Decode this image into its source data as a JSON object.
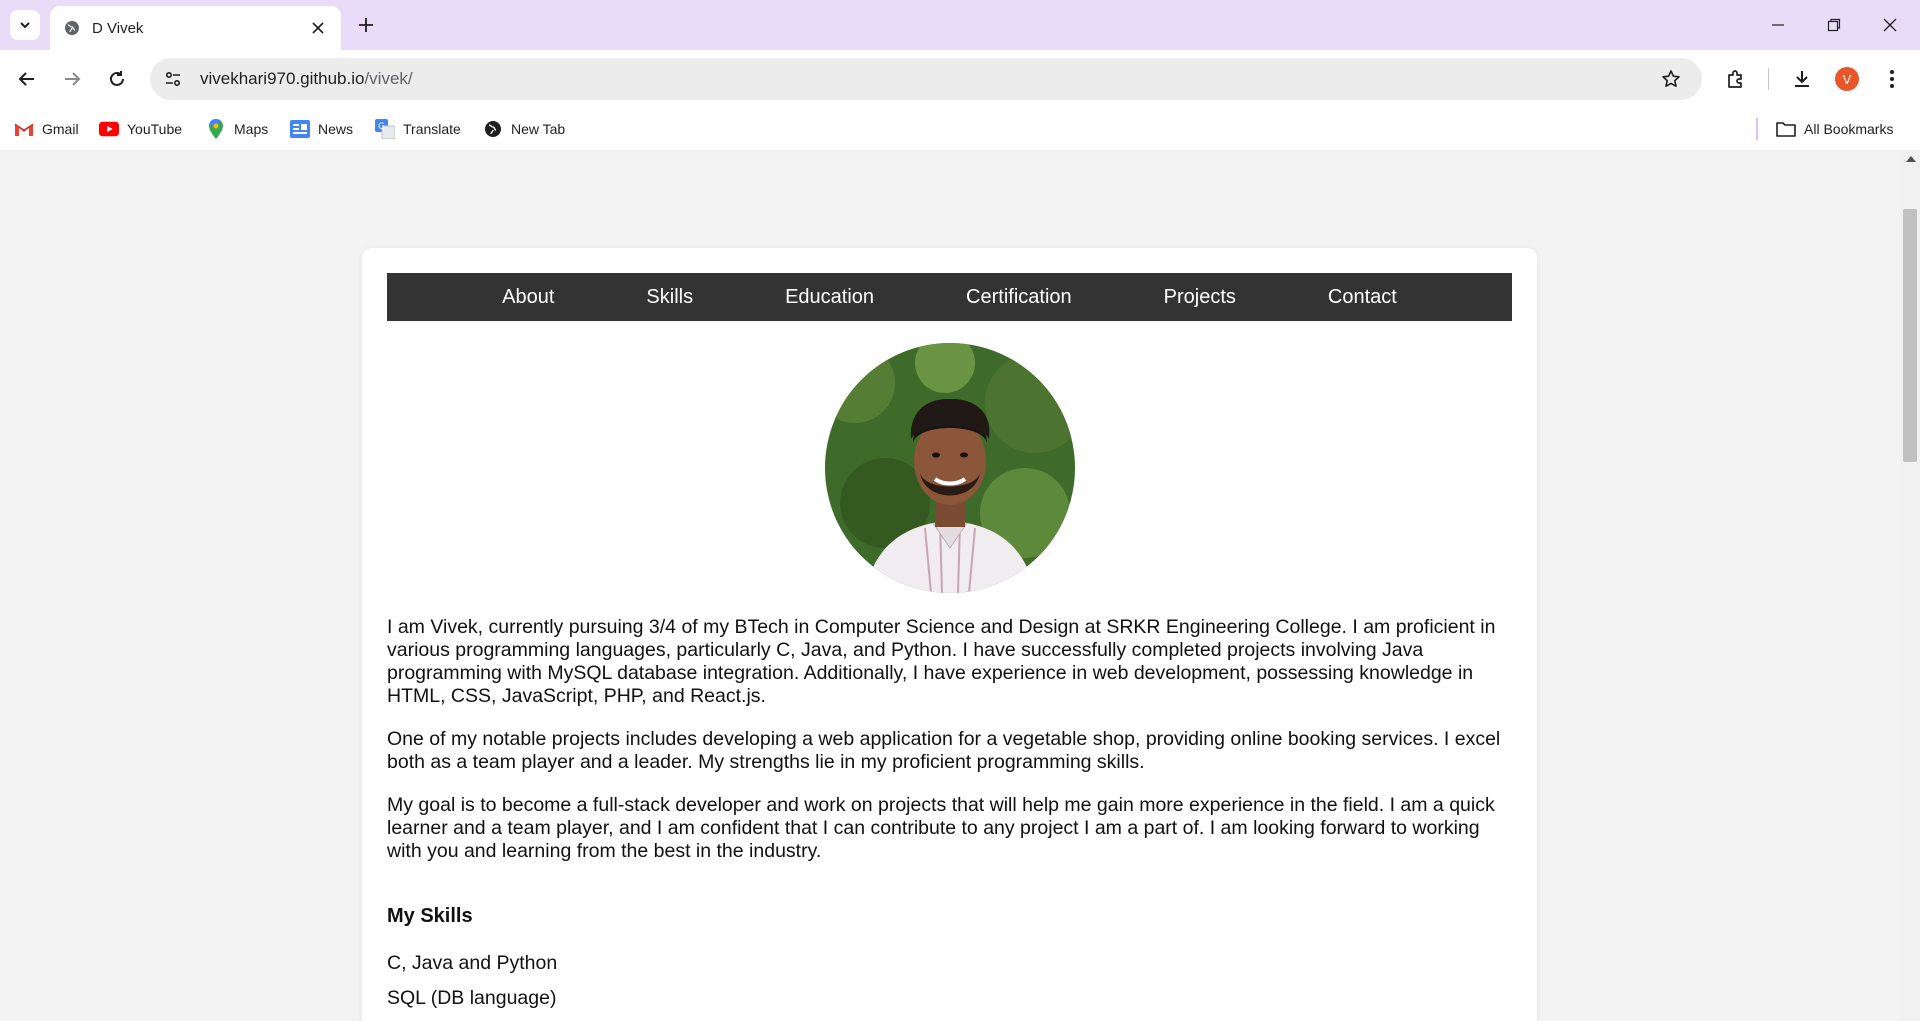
{
  "browser": {
    "tab_title": "D Vivek",
    "url_host": "vivekhari970.github.io",
    "url_path": "/vivek/",
    "profile_initial": "V"
  },
  "bookmarks": {
    "items": [
      {
        "label": "Gmail",
        "icon": "gmail-icon"
      },
      {
        "label": "YouTube",
        "icon": "youtube-icon"
      },
      {
        "label": "Maps",
        "icon": "maps-icon"
      },
      {
        "label": "News",
        "icon": "news-icon"
      },
      {
        "label": "Translate",
        "icon": "translate-icon"
      },
      {
        "label": "New Tab",
        "icon": "globe-icon"
      }
    ],
    "all_bookmarks": "All Bookmarks"
  },
  "page": {
    "nav": [
      "About",
      "Skills",
      "Education",
      "Certification",
      "Projects",
      "Contact"
    ],
    "about": [
      "I am Vivek, currently pursuing 3/4 of my BTech in Computer Science and Design at SRKR Engineering College. I am proficient in various programming languages, particularly C, Java, and Python. I have successfully completed projects involving Java programming with MySQL database integration. Additionally, I have experience in web development, possessing knowledge in HTML, CSS, JavaScript, PHP, and React.js.",
      "One of my notable projects includes developing a web application for a vegetable shop, providing online booking services. I excel both as a team player and a leader. My strengths lie in my proficient programming skills.",
      "My goal is to become a full-stack developer and work on projects that will help me gain more experience in the field. I am a quick learner and a team player, and I am confident that I can contribute to any project I am a part of. I am looking forward to working with you and learning from the best in the industry."
    ],
    "skills_heading": "My Skills",
    "skills": [
      "C, Java and Python",
      "SQL (DB language)"
    ]
  },
  "colors": {
    "tabstrip": "#e9dcf8",
    "nav_bg": "#333333",
    "page_bg": "#f3f3f3",
    "avatar": "#e8562a"
  }
}
